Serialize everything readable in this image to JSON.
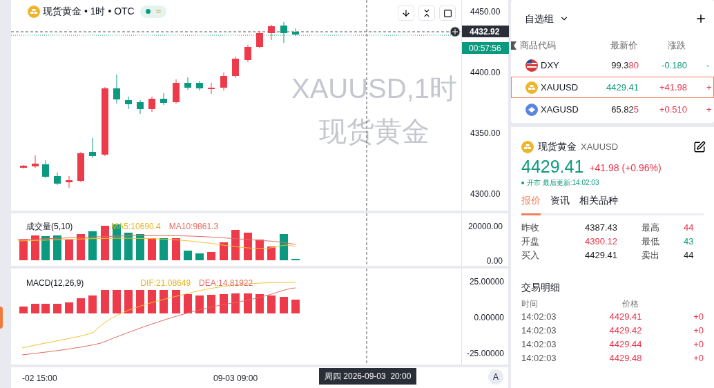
{
  "chart": {
    "header": {
      "symbol": "现货黄金",
      "interval": "1时",
      "market": "OTC",
      "separator": "•",
      "live": true,
      "wave": "≈"
    },
    "watermark": [
      "XAUUSD,1时",
      "现货黄金"
    ],
    "price_axis": [
      "4450.00",
      "4400.00",
      "4350.00",
      "4300.00"
    ],
    "current_price": "4432.92",
    "countdown": "00:57:56",
    "volume": {
      "label": "成交量(5,10)",
      "ma5": "MA5:10690.4",
      "ma10": "MA10:9861.3",
      "axis": [
        "20000.00",
        "0.00"
      ]
    },
    "macd": {
      "label": "MACD(12,26,9)",
      "dif": "DIF:21.08649",
      "dea": "DEA:14.81922",
      "axis": [
        "25.00000",
        "0.00000",
        "-25.00000"
      ]
    },
    "time_axis": [
      "-02 15:00",
      "09-03 09:00"
    ],
    "crosshair_time": "周四 2026-09-03  20:00",
    "scale_button": "A"
  },
  "watchlist": {
    "title": "自选组",
    "columns": [
      "商品代码",
      "最新价",
      "涨跌"
    ],
    "rows": [
      {
        "kind": "flag",
        "symbol": "DXY",
        "price": {
          "text": "99.3",
          "color": "#222222"
        },
        "tick": {
          "text": "80",
          "color": "#e8334a"
        },
        "change": {
          "text": "-0.180",
          "color": "#0e9a7c"
        },
        "column_4": "-",
        "selected": false
      },
      {
        "kind": "ingot",
        "symbol": "XAUUSD",
        "price": {
          "text": "4429.41",
          "color": "#0e9a7c"
        },
        "change": {
          "text": "+41.98",
          "color": "#e8334a"
        },
        "column_4": "+",
        "selected": true
      },
      {
        "kind": "diamond",
        "symbol": "XAGUSD",
        "price": {
          "text": "65.82",
          "color": "#222222"
        },
        "tick": {
          "text": "5",
          "color": "#e8334a"
        },
        "change": {
          "text": "+0.510",
          "color": "#e8334a"
        },
        "column_4": "+",
        "selected": false
      }
    ]
  },
  "detail": {
    "name": "现货黄金",
    "code": "XAUUSD",
    "price": {
      "text": "4429.41",
      "color": "#0e9a7c"
    },
    "change": {
      "text": "+41.98 (+0.96%)",
      "color": "#e8334a"
    },
    "status": {
      "open": true,
      "text": "开市 最后更新:14:02:03"
    },
    "tabs": [
      {
        "label": "报价",
        "selected": true
      },
      {
        "label": "资讯",
        "selected": false
      },
      {
        "label": "相关品种",
        "selected": false
      }
    ],
    "stats": [
      [
        {
          "label": "昨收",
          "value": "4387.43",
          "color": "#222222"
        },
        {
          "label": "最高",
          "value": "44",
          "color": "#e8334a"
        }
      ],
      [
        {
          "label": "开盘",
          "value": "4390.12",
          "color": "#e8334a"
        },
        {
          "label": "最低",
          "value": "43",
          "color": "#0e9a7c"
        }
      ],
      [
        {
          "label": "买入",
          "value": "4429.41",
          "color": "#222222"
        },
        {
          "label": "卖出",
          "value": "44",
          "color": "#222222"
        }
      ]
    ],
    "trades": {
      "title": "交易明细",
      "columns": [
        "时间",
        "价格"
      ],
      "rows": [
        {
          "time": "14:02:03",
          "price": "4429.41",
          "column_3": "+0"
        },
        {
          "time": "14:02:03",
          "price": "4429.42",
          "column_3": "+0"
        },
        {
          "time": "14:02:03",
          "price": "4429.44",
          "column_3": "+0"
        },
        {
          "time": "14:02:03",
          "price": "4429.48",
          "column_3": "+0"
        }
      ]
    }
  }
}
